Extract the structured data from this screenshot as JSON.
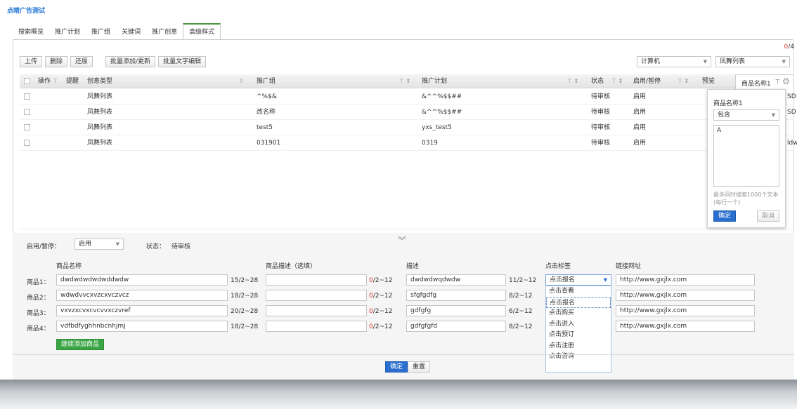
{
  "app": {
    "title": "点睛广告测试"
  },
  "tabs": [
    {
      "label": "搜索概览"
    },
    {
      "label": "推广计划"
    },
    {
      "label": "推广组"
    },
    {
      "label": "关键词"
    },
    {
      "label": "推广创意"
    },
    {
      "label": "高级样式",
      "active": true
    }
  ],
  "pagination": {
    "current": "0",
    "total": "/4"
  },
  "toolbar": {
    "upload": "上传",
    "delete": "删除",
    "restore": "还原",
    "batch_add": "批量添加/更新",
    "batch_text": "批量文字编辑",
    "device_select": "计算机",
    "style_select": "凤舞列表"
  },
  "grid": {
    "headers": {
      "ops": "操作",
      "remind": "提醒",
      "type": "创意类型",
      "group": "推广组",
      "plan": "推广计划",
      "status": "状态",
      "enable": "启用/暂停",
      "preview": "预览",
      "product": "商品名称1"
    },
    "rows": [
      {
        "type": "凤舞列表",
        "group": "^%$&",
        "plan": "&^^%$$##",
        "status": "待审核",
        "enable": "启用",
        "extra": "SD!"
      },
      {
        "type": "凤舞列表",
        "group": "改名称",
        "plan": "&^^%$$##",
        "status": "待审核",
        "enable": "启用",
        "extra": "SD!"
      },
      {
        "type": "凤舞列表",
        "group": "test5",
        "plan": "yxs_test5",
        "status": "待审核",
        "enable": "启用",
        "extra": ""
      },
      {
        "type": "凤舞列表",
        "group": "031901",
        "plan": "0319",
        "status": "待审核",
        "enable": "启用",
        "extra": "ldw"
      }
    ]
  },
  "filter_popup": {
    "title": "商品名称1",
    "mode": "包含",
    "value": "A",
    "hint": "最多同时搜索1000个文本(每行一个)",
    "ok": "确定",
    "cancel": "取消"
  },
  "editor": {
    "enable_label": "启用/暂停：",
    "enable_value": "启用",
    "status_label": "状态：",
    "status_value": "待审核",
    "col_name": "商品名称",
    "col_desc_opt": "商品描述（选填）",
    "col_desc": "描述",
    "col_tag": "点击标签",
    "col_url": "链接网址",
    "products": [
      {
        "label": "商品1：",
        "name": "dwdwdwdwdwddwdw",
        "name_count": "15/2~28",
        "desc_opt": "",
        "opt_cur": "0",
        "opt_range": "/2~12",
        "desc": "dwdwdwqdwdw",
        "desc_count": "11/2~12",
        "tag": "点击报名",
        "url": "http://www.gxjlx.com"
      },
      {
        "label": "商品2：",
        "name": "wdwdvvcxvzcxvczvcz",
        "name_count": "18/2~28",
        "desc_opt": "",
        "opt_cur": "0",
        "opt_range": "/2~12",
        "desc": "sfgfgdfg",
        "desc_count": "8/2~12",
        "tag": "点击报名",
        "url": "http://www.gxjlx.com"
      },
      {
        "label": "商品3：",
        "name": "vxvzxcvxcvcvvxczvref",
        "name_count": "20/2~28",
        "desc_opt": "",
        "opt_cur": "0",
        "opt_range": "/2~12",
        "desc": "gdfgfg",
        "desc_count": "6/2~12",
        "tag": "",
        "url": "http://www.gxjlx.com"
      },
      {
        "label": "商品4：",
        "name": "vdfbdfyghhnbcnhjmj",
        "name_count": "18/2~28",
        "desc_opt": "",
        "opt_cur": "0",
        "opt_range": "/2~12",
        "desc": "gdfgfgfd",
        "desc_count": "8/2~12",
        "tag": "",
        "url": "http://www.gxjlx.com"
      }
    ],
    "add_product": "继续添加商品",
    "tag_options": [
      "点击查看",
      "点击报名",
      "点击购买",
      "点击进入",
      "点击预订",
      "点击注册",
      "点击咨询"
    ],
    "confirm": "确定",
    "reset": "重置"
  },
  "colors": {
    "accent_blue": "#2a6fcf",
    "green": "#3aa545",
    "red": "#e03a2e",
    "tab_active": "#4b9a3c"
  }
}
